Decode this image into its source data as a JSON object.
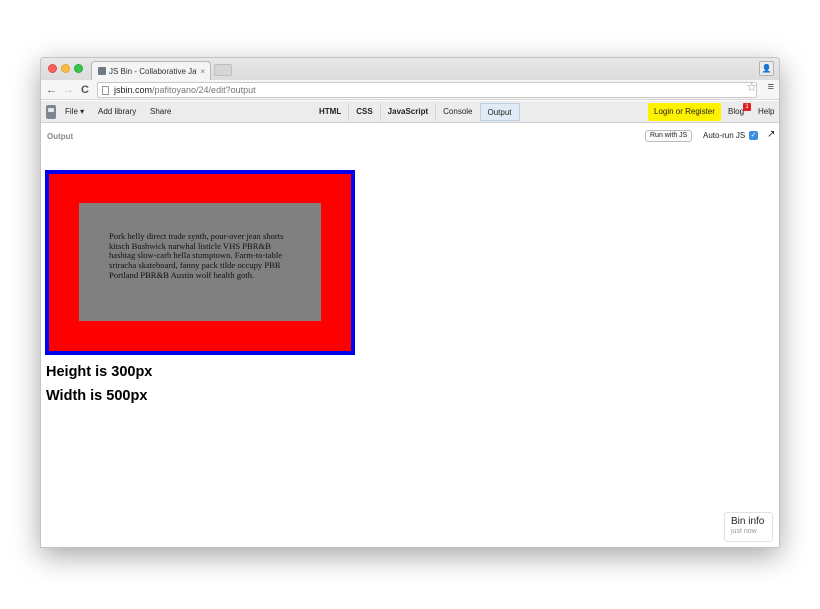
{
  "browser": {
    "tab_title": "JS Bin - Collaborative Jav",
    "tab_close": "×",
    "url_host": "jsbin.com",
    "url_path": "/pafitoyano/24/edit?output"
  },
  "toolbar": {
    "file_label": "File ▾",
    "add_library_label": "Add library",
    "share_label": "Share",
    "panels": [
      {
        "label": "HTML"
      },
      {
        "label": "CSS"
      },
      {
        "label": "JavaScript"
      },
      {
        "label": "Console"
      },
      {
        "label": "Output"
      }
    ],
    "login_label": "Login or Register",
    "blog_label": "Blog",
    "blog_badge": "1",
    "help_label": "Help"
  },
  "output_header": {
    "title": "Output",
    "run_label": "Run with JS",
    "autorun_label": "Auto-run JS"
  },
  "output": {
    "paragraph": "Pork belly direct trade synth, pour-over jean shorts kitsch Bushwick narwhal listicle VHS PBR&B hashtag slow-carb hella stumptown. Farm-to-table sriracha skateboard, fanny pack tilde occupy PBR Portland PBR&B Austin wolf health goth.",
    "height_text": "Height is 300px",
    "width_text": "Width is 500px"
  },
  "bin_info": {
    "title": "Bin info",
    "time": "just now"
  },
  "colors": {
    "outer_border": "#0000ee",
    "red_area": "#ff0000",
    "gray_content": "#808080",
    "login_highlight": "#fff200"
  }
}
